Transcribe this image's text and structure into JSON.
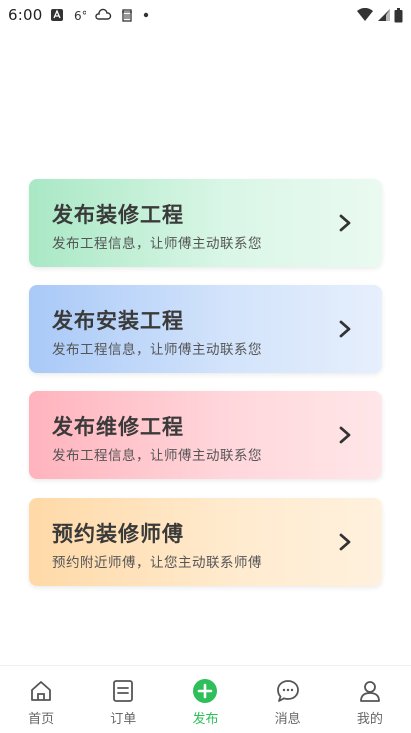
{
  "status_bar": {
    "time": "6:00",
    "icons": [
      "app-notification-icon",
      "hashtag-icon",
      "cloud-icon",
      "trash-icon",
      "dot-icon",
      "wifi-icon",
      "signal-icon",
      "battery-icon"
    ]
  },
  "cards": [
    {
      "title": "发布装修工程",
      "subtitle": "发布工程信息，让师傅主动联系您",
      "color": "#a9e8c5"
    },
    {
      "title": "发布安装工程",
      "subtitle": "发布工程信息，让师傅主动联系您",
      "color": "#a9c9f7"
    },
    {
      "title": "发布维修工程",
      "subtitle": "发布工程信息，让师傅主动联系您",
      "color": "#ffb3bd"
    },
    {
      "title": "预约装修师傅",
      "subtitle": "预约附近师傅，让您主动联系师傅",
      "color": "#ffd9a7"
    }
  ],
  "tabbar": {
    "active_color": "#2fbf5a",
    "items": [
      {
        "label": "首页",
        "icon": "home-icon"
      },
      {
        "label": "订单",
        "icon": "order-list-icon"
      },
      {
        "label": "发布",
        "icon": "plus-circle-icon",
        "active": true
      },
      {
        "label": "消息",
        "icon": "chat-bubble-icon"
      },
      {
        "label": "我的",
        "icon": "user-icon"
      }
    ]
  }
}
